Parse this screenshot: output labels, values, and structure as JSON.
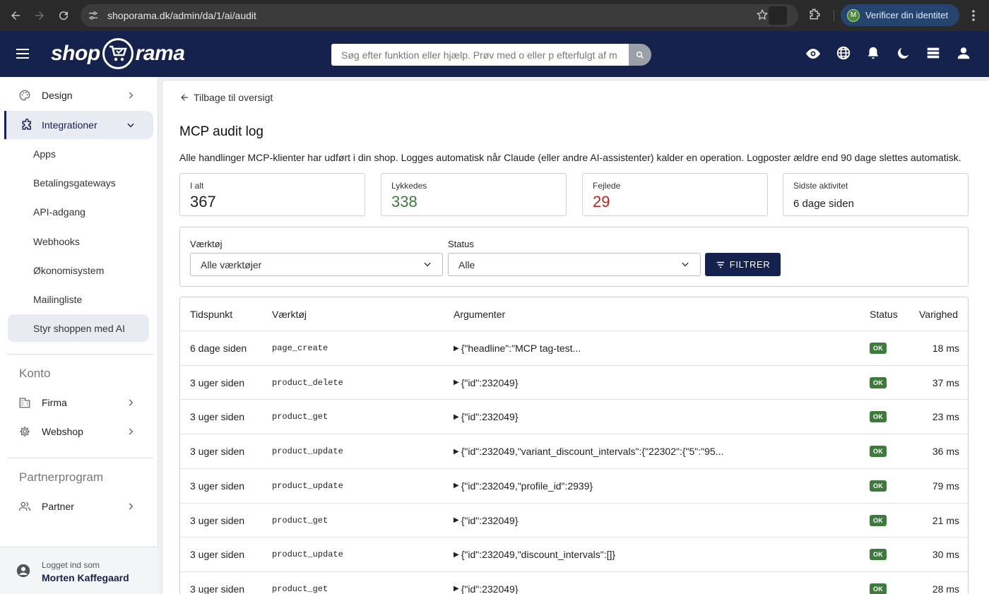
{
  "browser": {
    "url": "shoporama.dk/admin/da/1/ai/audit",
    "verify_label": "Verificer din identitet",
    "avatar_initial": "M"
  },
  "header": {
    "logo_left": "shop",
    "logo_right": "rama",
    "search_placeholder": "Søg efter funktion eller hjælp. Prøv med o eller p efterfulgt af mellemrum"
  },
  "sidebar": {
    "design": "Design",
    "integrationer": "Integrationer",
    "sub_items": [
      "Apps",
      "Betalingsgateways",
      "API-adgang",
      "Webhooks",
      "Økonomisystem",
      "Mailingliste",
      "Styr shoppen med AI"
    ],
    "konto_heading": "Konto",
    "firma": "Firma",
    "webshop": "Webshop",
    "partner_heading": "Partnerprogram",
    "partner": "Partner",
    "footer_label": "Logget ind som",
    "footer_name": "Morten Kaffegaard"
  },
  "main": {
    "back_label": "Tilbage til oversigt",
    "title": "MCP audit log",
    "description": "Alle handlinger MCP-klienter har udført i din shop. Logges automatisk når Claude (eller andre AI-assistenter) kalder en operation. Logposter ældre end 90 dage slettes automatisk.",
    "stats": [
      {
        "label": "I alt",
        "value": "367"
      },
      {
        "label": "Lykkedes",
        "value": "338"
      },
      {
        "label": "Fejlede",
        "value": "29"
      },
      {
        "label": "Sidste aktivitet",
        "value": "6 dage siden"
      }
    ],
    "filters": {
      "tool_label": "Værktøj",
      "tool_value": "Alle værktøjer",
      "status_label": "Status",
      "status_value": "Alle",
      "button": "FILTRER"
    },
    "table": {
      "headers": [
        "Tidspunkt",
        "Værktøj",
        "Argumenter",
        "Status",
        "Varighed"
      ],
      "rows": [
        {
          "time": "6 dage siden",
          "tool": "page_create",
          "args": "{\"headline\":\"MCP tag-test...",
          "status": "OK",
          "duration": "18 ms"
        },
        {
          "time": "3 uger siden",
          "tool": "product_delete",
          "args": "{\"id\":232049}",
          "status": "OK",
          "duration": "37 ms"
        },
        {
          "time": "3 uger siden",
          "tool": "product_get",
          "args": "{\"id\":232049}",
          "status": "OK",
          "duration": "23 ms"
        },
        {
          "time": "3 uger siden",
          "tool": "product_update",
          "args": "{\"id\":232049,\"variant_discount_intervals\":{\"22302\":{\"5\":\"95...",
          "status": "OK",
          "duration": "36 ms"
        },
        {
          "time": "3 uger siden",
          "tool": "product_update",
          "args": "{\"id\":232049,\"profile_id\":2939}",
          "status": "OK",
          "duration": "79 ms"
        },
        {
          "time": "3 uger siden",
          "tool": "product_get",
          "args": "{\"id\":232049}",
          "status": "OK",
          "duration": "21 ms"
        },
        {
          "time": "3 uger siden",
          "tool": "product_update",
          "args": "{\"id\":232049,\"discount_intervals\":[]}",
          "status": "OK",
          "duration": "30 ms"
        },
        {
          "time": "3 uger siden",
          "tool": "product_get",
          "args": "{\"id\":232049}",
          "status": "OK",
          "duration": "28 ms"
        }
      ]
    }
  },
  "colors": {
    "navy": "#15224d",
    "success": "#3f7a3d",
    "error": "#b3261e"
  }
}
